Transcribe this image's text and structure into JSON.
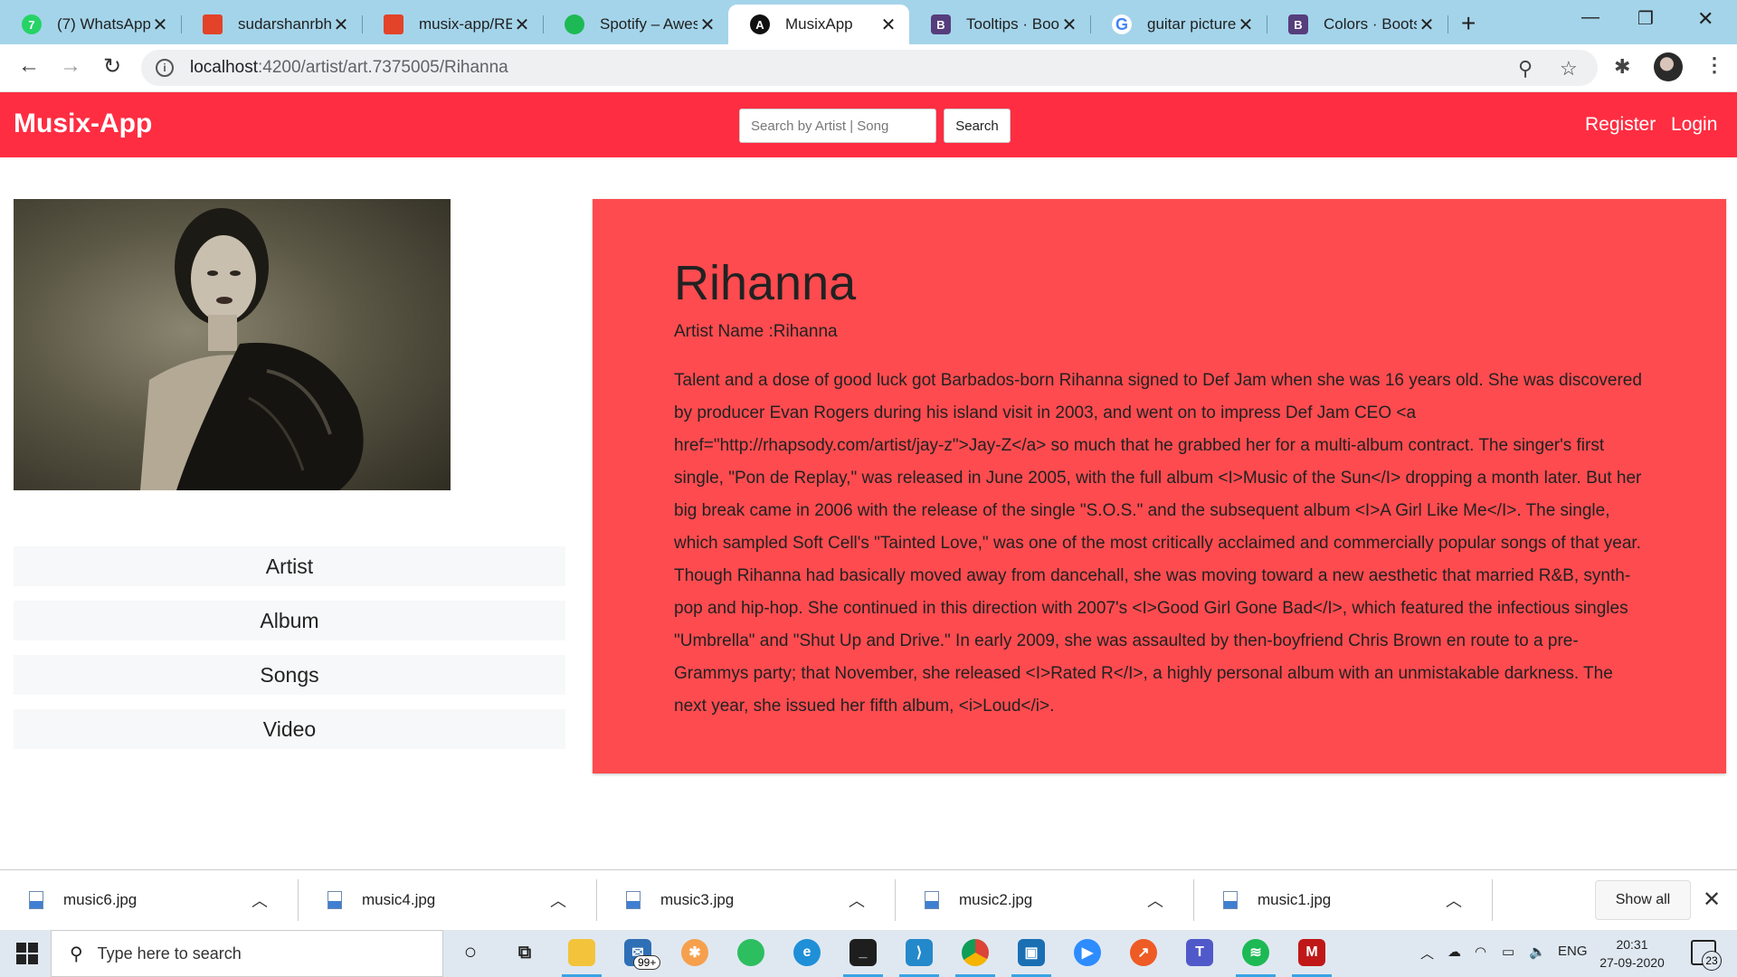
{
  "browser": {
    "tabs": [
      {
        "title": "(7) WhatsApp",
        "favicon": "whatsapp-icon",
        "badge": "7",
        "color": "#25d366"
      },
      {
        "title": "sudarshanrbha",
        "favicon": "gitlab-icon",
        "badge": "",
        "color": "#e24329"
      },
      {
        "title": "musix-app/REA",
        "favicon": "gitlab-icon",
        "badge": "",
        "color": "#e24329"
      },
      {
        "title": "Spotify – Awes",
        "favicon": "spotify-icon",
        "badge": "",
        "color": "#1db954"
      },
      {
        "title": "MusixApp",
        "favicon": "angular-icon",
        "badge": "A",
        "color": "#111111"
      },
      {
        "title": "Tooltips · Boots",
        "favicon": "bootstrap-icon",
        "badge": "B",
        "color": "#563d7c"
      },
      {
        "title": "guitar pictures",
        "favicon": "google-icon",
        "badge": "G",
        "color": "#4285f4"
      },
      {
        "title": "Colors · Bootst",
        "favicon": "bootstrap-icon",
        "badge": "B",
        "color": "#563d7c"
      }
    ],
    "active_tab_index": 4,
    "new_tab_label": "+",
    "url_host": "localhost",
    "url_path": ":4200/artist/art.7375005/Rihanna"
  },
  "app": {
    "brand": "Musix-App",
    "search": {
      "placeholder": "Search by Artist | Song",
      "value": "",
      "button_label": "Search"
    },
    "nav": {
      "register": "Register",
      "login": "Login"
    },
    "accent_color": "#ff2d42"
  },
  "artist": {
    "heading": "Rihanna",
    "name_line": "Artist Name :Rihanna",
    "bio": "Talent and a dose of good luck got Barbados-born Rihanna signed to Def Jam when she was 16 years old. She was discovered by producer Evan Rogers during his island visit in 2003, and went on to impress Def Jam CEO <a href=\"http://rhapsody.com/artist/jay-z\">Jay-Z</a> so much that he grabbed her for a multi-album contract. The singer's first single, \"Pon de Replay,\" was released in June 2005, with the full album <I>Music of the Sun</I> dropping a month later. But her big break came in 2006 with the release of the single \"S.O.S.\" and the subsequent album <I>A Girl Like Me</I>. The single, which sampled Soft Cell's \"Tainted Love,\" was one of the most critically acclaimed and commercially popular songs of that year. Though Rihanna had basically moved away from dancehall, she was moving toward a new aesthetic that married R&B, synth-pop and hip-hop. She continued in this direction with 2007's <I>Good Girl Gone Bad</I>, which featured the infectious singles \"Umbrella\" and \"Shut Up and Drive.\" In early 2009, she was assaulted by then-boyfriend Chris Brown en route to a pre-Grammys party; that November, she released <I>Rated R</I>, a highly personal album with an unmistakable darkness. The next year, she issued her fifth album, <i>Loud</i>.",
    "panel_color": "#fe4b4f"
  },
  "side_menu": [
    "Artist",
    "Album",
    "Songs",
    "Video"
  ],
  "downloads": {
    "files": [
      "music6.jpg",
      "music4.jpg",
      "music3.jpg",
      "music2.jpg",
      "music1.jpg"
    ],
    "show_all": "Show all"
  },
  "taskbar": {
    "search_placeholder": "Type here to search",
    "mail_badge": "99+",
    "language": "ENG",
    "time": "20:31",
    "date": "27-09-2020",
    "notification_count": "23",
    "apps": [
      "task-view-icon",
      "file-explorer-icon",
      "mail-icon",
      "snip-icon",
      "evernote-icon",
      "edge-icon",
      "terminal-icon",
      "vscode-icon",
      "chrome-icon",
      "jetbrains-icon",
      "zoom-icon",
      "postman-icon",
      "teams-icon",
      "spotify-icon",
      "mcafee-icon"
    ]
  }
}
